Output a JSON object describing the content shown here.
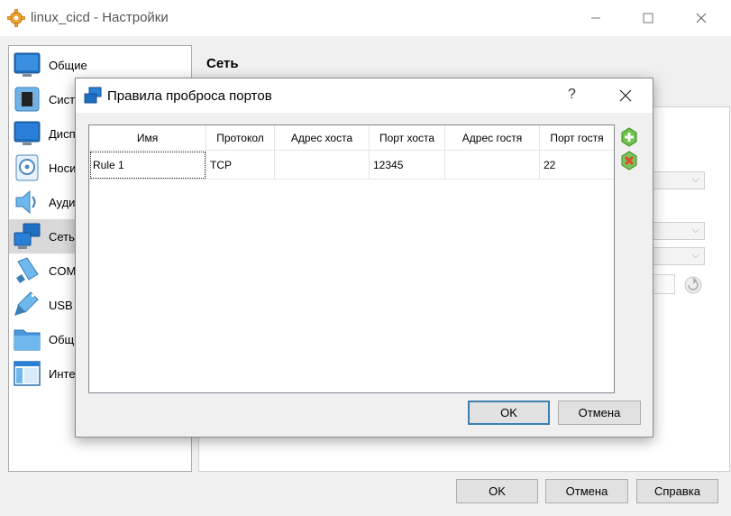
{
  "window": {
    "title": "linux_cicd - Настройки",
    "minimize": "—",
    "maximize": "☐",
    "close": "✕"
  },
  "sidebar": {
    "items": [
      {
        "label": "Общие",
        "icon": "general-monitor-icon",
        "selected": false
      },
      {
        "label": "Систе",
        "icon": "chip-icon",
        "selected": false
      },
      {
        "label": "Дисп",
        "icon": "display-icon",
        "selected": false
      },
      {
        "label": "Носит",
        "icon": "disk-icon",
        "selected": false
      },
      {
        "label": "Ауди",
        "icon": "speaker-icon",
        "selected": false
      },
      {
        "label": "Сеть",
        "icon": "network-icon",
        "selected": true
      },
      {
        "label": "COM-",
        "icon": "serial-port-icon",
        "selected": false
      },
      {
        "label": "USB",
        "icon": "usb-icon",
        "selected": false
      },
      {
        "label": "Общи",
        "icon": "shared-folder-icon",
        "selected": false
      },
      {
        "label": "Интер",
        "icon": "user-interface-icon",
        "selected": false
      }
    ]
  },
  "main": {
    "section_title": "Сеть"
  },
  "footer": {
    "ok": "OK",
    "cancel": "Отмена",
    "help": "Справка"
  },
  "dialog": {
    "title": "Правила проброса портов",
    "help": "?",
    "close": "✕",
    "columns": [
      "Имя",
      "Протокол",
      "Адрес хоста",
      "Порт хоста",
      "Адрес гостя",
      "Порт гостя"
    ],
    "rows": [
      [
        "Rule 1",
        "TCP",
        "",
        "12345",
        "",
        "22"
      ]
    ],
    "ok": "OK",
    "cancel": "Отмена",
    "add_rule_icon": "add-rule-icon",
    "remove_rule_icon": "remove-rule-icon"
  },
  "colors": {
    "accent": "#3c7fb1",
    "selected_item": "#d9d9d9",
    "add_green": "#4caf2f",
    "remove_red": "#e04b2b"
  }
}
